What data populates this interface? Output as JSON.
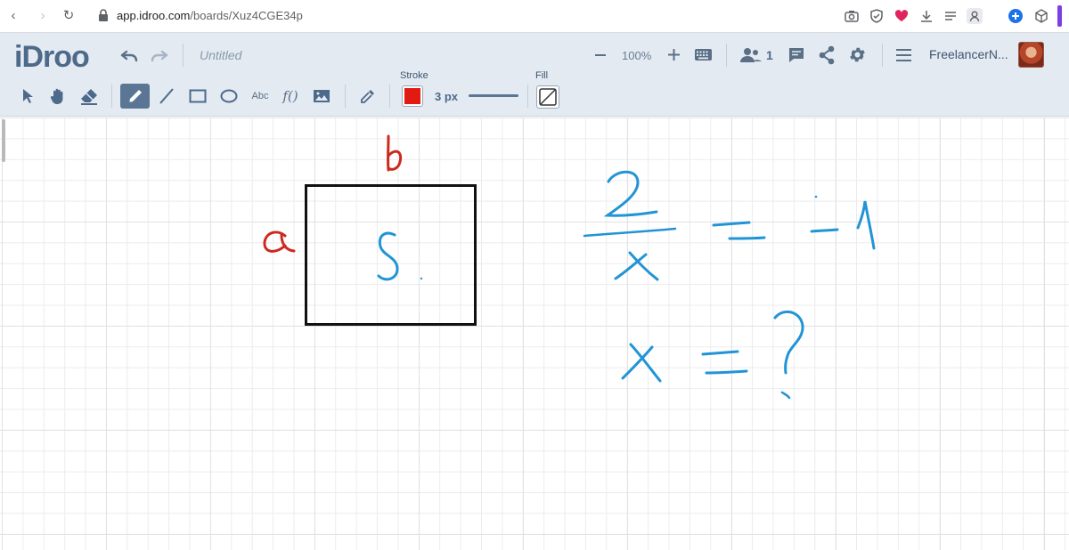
{
  "browser": {
    "url_host": "app.idroo.com",
    "url_path": "/boards/Xuz4CGE34p"
  },
  "app": {
    "logo": "iDroo",
    "board_title": "Untitled",
    "zoom": "100%",
    "users_count": "1",
    "username": "FreelancerN..."
  },
  "toolbar": {
    "text_tool_label": "Abc",
    "formula_tool_label": "f()",
    "stroke_label": "Stroke",
    "stroke_color": "#e21a12",
    "stroke_width": "3 px",
    "fill_label": "Fill"
  },
  "colors": {
    "accent": "#4d6a8a",
    "header_bg": "#e3eaf2",
    "ink_red": "#cc2a1e",
    "ink_blue": "#2294d6",
    "ink_black": "#111111"
  }
}
